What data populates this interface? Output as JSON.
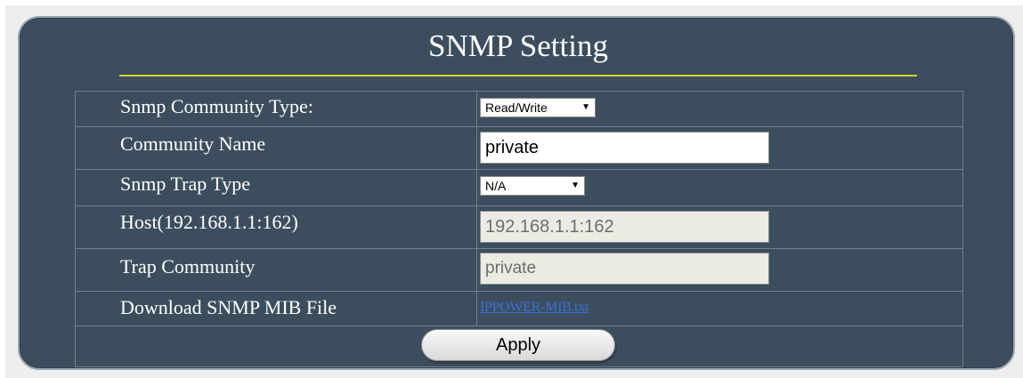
{
  "page": {
    "title": "SNMP Setting"
  },
  "colors": {
    "panel_bg": "#3c4e5d",
    "title_rule": "#d8d23a",
    "link": "#3a6fd8"
  },
  "form": {
    "community_type": {
      "label": "Snmp Community Type:",
      "selected": "Read/Write",
      "arrow_icon": "dropdown-arrow-icon"
    },
    "community_name": {
      "label": "Community Name",
      "value": "private"
    },
    "trap_type": {
      "label": "Snmp Trap Type",
      "selected": "N/A",
      "arrow_icon": "dropdown-arrow-icon"
    },
    "host": {
      "label": "Host(192.168.1.1:162)",
      "value": "192.168.1.1:162"
    },
    "trap_community": {
      "label": "Trap Community",
      "value": "private"
    },
    "mib": {
      "label": "Download SNMP MIB File",
      "link_text": "IPPOWER-MIB.txt"
    },
    "apply_label": "Apply"
  }
}
